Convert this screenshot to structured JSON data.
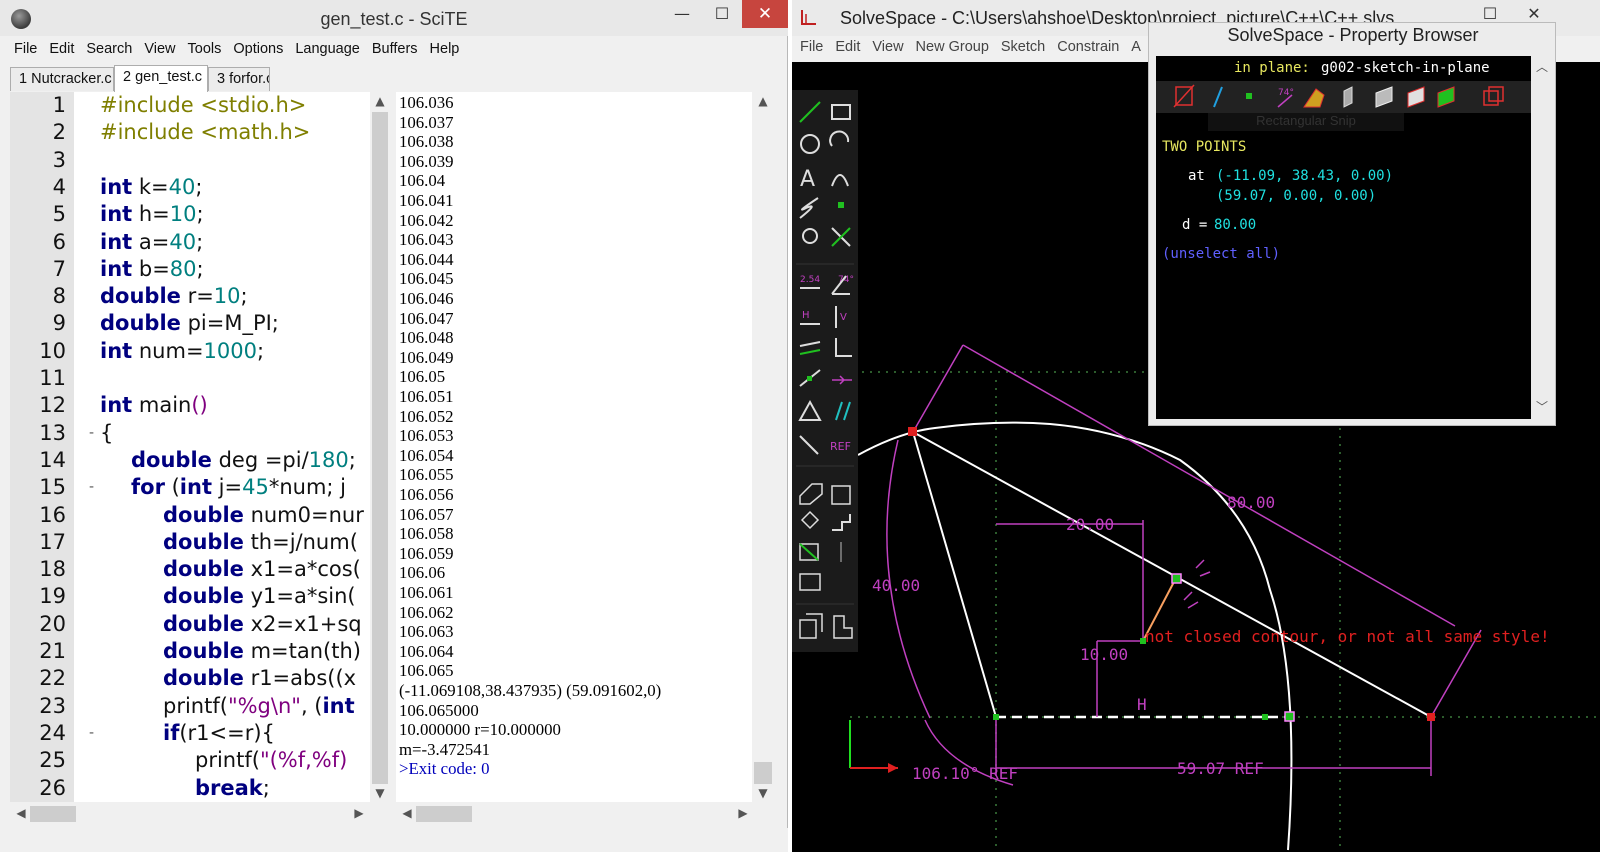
{
  "scite": {
    "title": "gen_test.c - SciTE",
    "window_controls": {
      "minimize": "—",
      "maximize": "☐",
      "close": "✕"
    },
    "menu": [
      "File",
      "Edit",
      "Search",
      "View",
      "Tools",
      "Options",
      "Language",
      "Buffers",
      "Help"
    ],
    "tabs": [
      {
        "label": "1 Nutcracker.c",
        "active": false
      },
      {
        "label": "2 gen_test.c",
        "active": true
      },
      {
        "label": "3 forfor.c",
        "active": false
      }
    ],
    "code_lines": [
      {
        "n": "1",
        "text": "#include <stdio.h>"
      },
      {
        "n": "2",
        "text": "#include <math.h>"
      },
      {
        "n": "3",
        "text": ""
      },
      {
        "n": "4",
        "text": "int k=40;"
      },
      {
        "n": "5",
        "text": "int h=10;"
      },
      {
        "n": "6",
        "text": "int a=40;"
      },
      {
        "n": "7",
        "text": "int b=80;"
      },
      {
        "n": "8",
        "text": "double r=10;"
      },
      {
        "n": "9",
        "text": "double pi=M_PI;"
      },
      {
        "n": "10",
        "text": "int num=1000;"
      },
      {
        "n": "11",
        "text": ""
      },
      {
        "n": "12",
        "text": "int main()"
      },
      {
        "n": "13",
        "text": "{"
      },
      {
        "n": "14",
        "text": "double deg =pi/180;"
      },
      {
        "n": "15",
        "text": "for (int j=45*num; j"
      },
      {
        "n": "16",
        "text": "double num0=nur"
      },
      {
        "n": "17",
        "text": "double th=j/num("
      },
      {
        "n": "18",
        "text": "double x1=a*cos("
      },
      {
        "n": "19",
        "text": "double y1=a*sin("
      },
      {
        "n": "20",
        "text": "double x2=x1+sq"
      },
      {
        "n": "21",
        "text": "double m=tan(th)"
      },
      {
        "n": "22",
        "text": "double r1=abs((x"
      },
      {
        "n": "23",
        "text": "printf(\"%g\\n\", (int"
      },
      {
        "n": "24",
        "text": "if(r1<=r){"
      },
      {
        "n": "25",
        "text": "printf(\"(%f,%f)"
      },
      {
        "n": "26",
        "text": "break;"
      }
    ],
    "output_lines": [
      "106.036",
      "106.037",
      "106.038",
      "106.039",
      "106.04",
      "106.041",
      "106.042",
      "106.043",
      "106.044",
      "106.045",
      "106.046",
      "106.047",
      "106.048",
      "106.049",
      "106.05",
      "106.051",
      "106.052",
      "106.053",
      "106.054",
      "106.055",
      "106.056",
      "106.057",
      "106.058",
      "106.059",
      "106.06",
      "106.061",
      "106.062",
      "106.063",
      "106.064",
      "106.065",
      "(-11.069108,38.437935) (59.091602,0)",
      "106.065000",
      "10.000000 r=10.000000",
      "m=-3.472541",
      ">Exit code: 0"
    ]
  },
  "solvespace": {
    "title": "SolveSpace - C:\\Users\\ahshoe\\Desktop\\project_picture\\C++\\C++.slvs",
    "menu": [
      "File",
      "Edit",
      "View",
      "New Group",
      "Sketch",
      "Constrain",
      "A"
    ],
    "sketch_labels": {
      "dim_80": "80.00",
      "dim_20": "20.00",
      "dim_40": "40.00",
      "dim_10": "10.00",
      "horizontal": "H",
      "angle": "106.10° REF",
      "dim_59": "59.07 REF",
      "error": "not closed contour, or not all same style!"
    },
    "toolbar_labels": {
      "dim": "2.54",
      "angle": "74°",
      "h": "H",
      "v": "V",
      "ref": "REF"
    },
    "property_browser": {
      "title": "SolveSpace - Property Browser",
      "in_plane_label": "in plane:",
      "in_plane_value": "g002-sketch-in-plane",
      "tooltip": "Rectangular Snip",
      "section": "TWO POINTS",
      "at_label": "at",
      "point1": "(-11.09, 38.43, 0.00)",
      "point2": "(59.07, 0.00, 0.00)",
      "d_label": "d =",
      "d_value": "80.00",
      "unselect": "(unselect all)"
    }
  }
}
